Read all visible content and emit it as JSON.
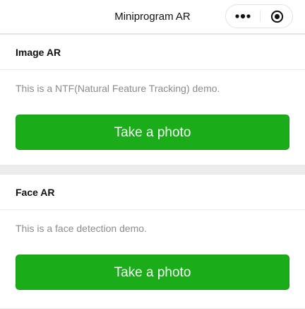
{
  "nav": {
    "title": "Miniprogram AR",
    "more_icon": "more-dots-icon",
    "close_icon": "target-circle-icon"
  },
  "cards": [
    {
      "title": "Image AR",
      "description": "This is a NTF(Natural Feature Tracking) demo.",
      "button_label": "Take a photo"
    },
    {
      "title": "Face AR",
      "description": "This is a face detection demo.",
      "button_label": "Take a photo"
    }
  ],
  "colors": {
    "primary_button": "#1aad19",
    "page_background": "#ececec",
    "description_text": "#8c8c8c"
  }
}
